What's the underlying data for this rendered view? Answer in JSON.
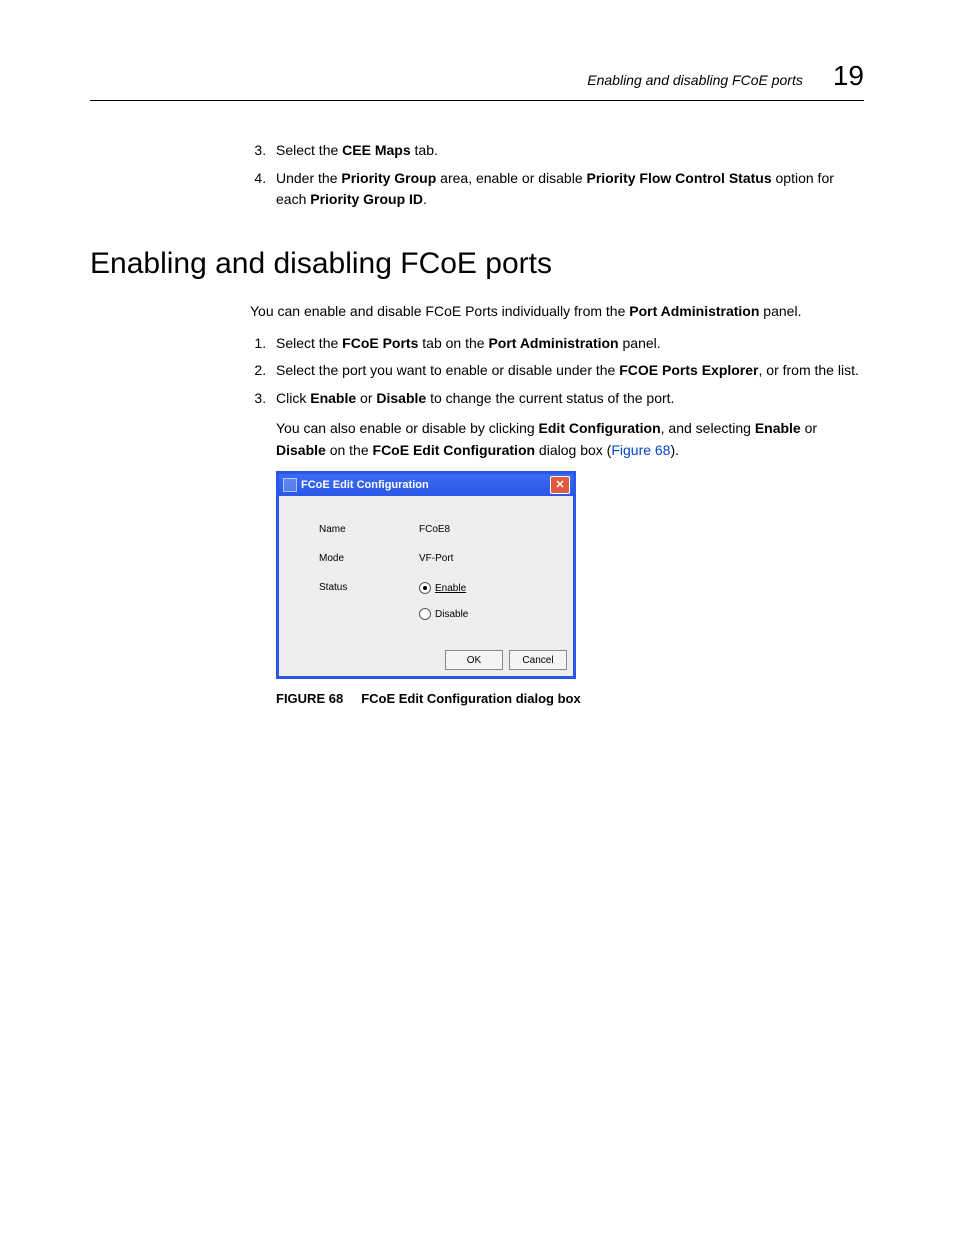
{
  "header": {
    "running_title": "Enabling and disabling FCoE ports",
    "page_number": "19"
  },
  "list_a": {
    "start": 3,
    "items": [
      {
        "pre": "Select the ",
        "b1": "CEE Maps",
        "post": " tab."
      },
      {
        "pre": "Under the ",
        "b1": "Priority Group",
        "mid1": " area, enable or disable ",
        "b2": "Priority Flow Control Status",
        "mid2": " option for each ",
        "b3": "Priority Group ID",
        "post": "."
      }
    ]
  },
  "heading": "Enabling and disabling FCoE ports",
  "intro": {
    "pre": "You can enable and disable FCoE Ports individually from the ",
    "b1": "Port Administration",
    "post": " panel."
  },
  "list_b": {
    "start": 1,
    "items": [
      {
        "pre": "Select the ",
        "b1": "FCoE Ports",
        "mid1": " tab on the ",
        "b2": "Port Administration",
        "post": " panel."
      },
      {
        "pre": "Select the port you want to enable or disable under the ",
        "b1": "FCOE Ports Explorer",
        "post": ", or from the list."
      },
      {
        "pre": "Click ",
        "b1": "Enable",
        "mid1": " or ",
        "b2": "Disable",
        "post": " to change the current status of the port."
      }
    ]
  },
  "sub": {
    "pre": "You can also enable or disable by clicking ",
    "b1": "Edit Configuration",
    "mid1": ", and selecting ",
    "b2": "Enable",
    "mid2": " or ",
    "b3": "Disable",
    "mid3": " on the ",
    "b4": "FCoE Edit Configuration",
    "mid4": " dialog box (",
    "link": "Figure 68",
    "post": ")."
  },
  "dialog": {
    "title": "FCoE Edit Configuration",
    "rows": {
      "name_label": "Name",
      "name_value": "FCoE8",
      "mode_label": "Mode",
      "mode_value": "VF-Port",
      "status_label": "Status",
      "enable_label": "Enable",
      "disable_label": "Disable"
    },
    "buttons": {
      "ok": "OK",
      "cancel": "Cancel"
    }
  },
  "figure": {
    "number": "FIGURE 68",
    "title": "FCoE Edit Configuration dialog box"
  }
}
